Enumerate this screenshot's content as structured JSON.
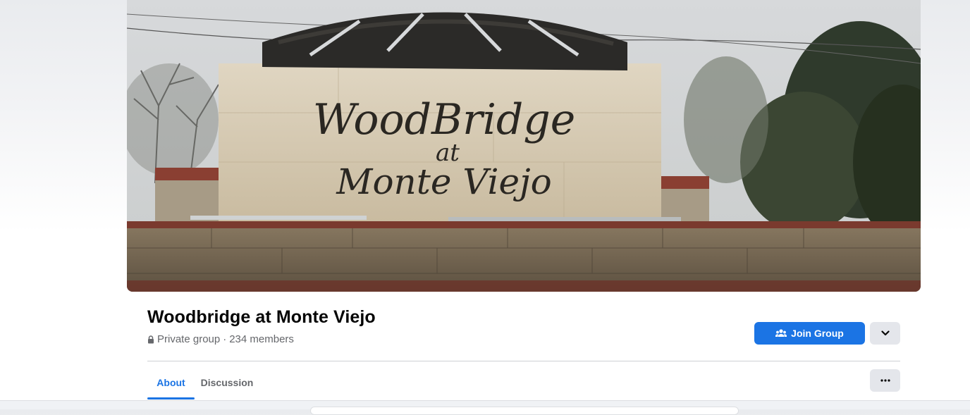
{
  "cover": {
    "sign_line1": "WoodBridge",
    "sign_line2": "at",
    "sign_line3": "Monte Viejo"
  },
  "group": {
    "name": "Woodbridge at Monte Viejo",
    "privacy": "Private group",
    "separator": "·",
    "members": "234 members"
  },
  "actions": {
    "join_label": "Join Group",
    "join_icon": "people-icon",
    "dropdown_icon": "chevron-down-icon",
    "more_icon": "ellipsis-icon"
  },
  "tabs": [
    {
      "label": "About",
      "active": true
    },
    {
      "label": "Discussion",
      "active": false
    }
  ],
  "colors": {
    "accent": "#1b74e4",
    "secondary_button": "#e4e6eb",
    "text_primary": "#050505",
    "text_secondary": "#65676b"
  }
}
